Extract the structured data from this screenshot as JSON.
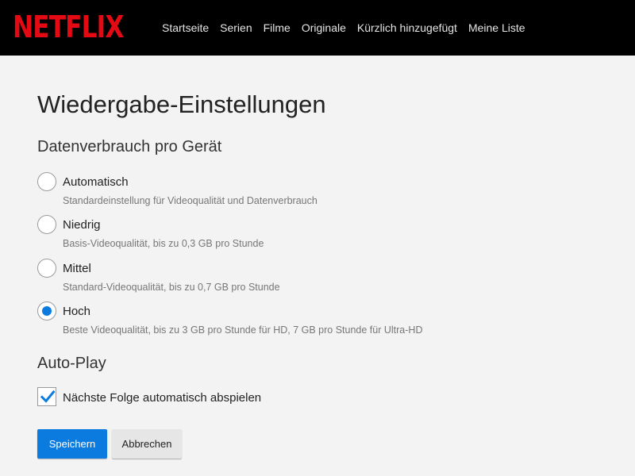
{
  "header": {
    "logo_text": "NETFLIX",
    "nav": [
      {
        "label": "Startseite"
      },
      {
        "label": "Serien"
      },
      {
        "label": "Filme"
      },
      {
        "label": "Originale"
      },
      {
        "label": "Kürzlich hinzugefügt"
      },
      {
        "label": "Meine Liste"
      }
    ]
  },
  "page": {
    "title": "Wiedergabe-Einstellungen",
    "data_usage": {
      "heading": "Datenverbrauch pro Gerät",
      "selected": "Hoch",
      "options": [
        {
          "label": "Automatisch",
          "desc": "Standardeinstellung für Videoqualität und Datenverbrauch",
          "checked": false
        },
        {
          "label": "Niedrig",
          "desc": "Basis-Videoqualität, bis zu 0,3 GB pro Stunde",
          "checked": false
        },
        {
          "label": "Mittel",
          "desc": "Standard-Videoqualität, bis zu 0,7 GB pro Stunde",
          "checked": false
        },
        {
          "label": "Hoch",
          "desc": "Beste Videoqualität, bis zu 3 GB pro Stunde für HD, 7 GB pro Stunde für Ultra-HD",
          "checked": true
        }
      ]
    },
    "autoplay": {
      "heading": "Auto-Play",
      "next_episode_label": "Nächste Folge automatisch abspielen",
      "next_episode_checked": true
    },
    "buttons": {
      "save_label": "Speichern",
      "cancel_label": "Abbrechen"
    }
  },
  "colors": {
    "brand_red": "#e50914",
    "accent_blue": "#0b7be0",
    "header_bg": "#000000",
    "page_bg": "#f3f3f3"
  }
}
